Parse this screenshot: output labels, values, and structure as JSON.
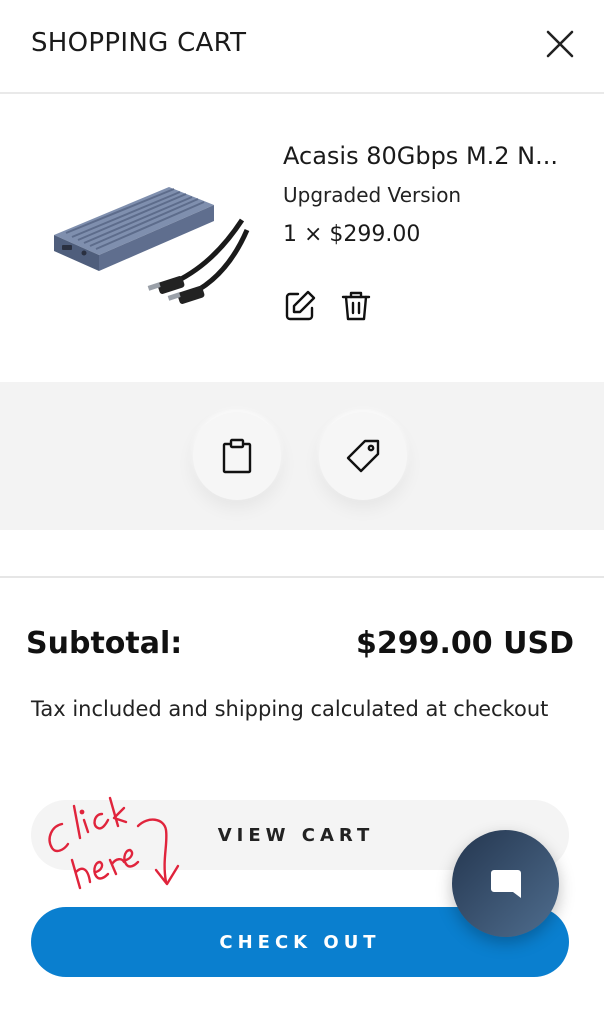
{
  "header": {
    "title": "SHOPPING CART",
    "close_icon": "close-icon"
  },
  "cart_item": {
    "title": "Acasis 80Gbps M.2 N...",
    "variant": "Upgraded Version",
    "price_line": "1 × $299.00",
    "edit_icon": "edit-icon",
    "delete_icon": "trash-icon"
  },
  "extras": {
    "note_icon": "clipboard-icon",
    "discount_icon": "tag-icon"
  },
  "summary": {
    "subtotal_label": "Subtotal:",
    "subtotal_value": "$299.00 USD",
    "tax_note": "Tax included and shipping calculated at checkout"
  },
  "actions": {
    "view_cart_label": "VIEW CART",
    "checkout_label": "CHECK OUT"
  },
  "annotation": {
    "text": "Click here"
  },
  "chat": {
    "icon": "chat-icon"
  },
  "colors": {
    "checkout": "#0a7fcf",
    "band": "#f3f3f3",
    "annotation": "#e0243c",
    "chat_start": "#24364f",
    "chat_end": "#4f6d8e"
  }
}
